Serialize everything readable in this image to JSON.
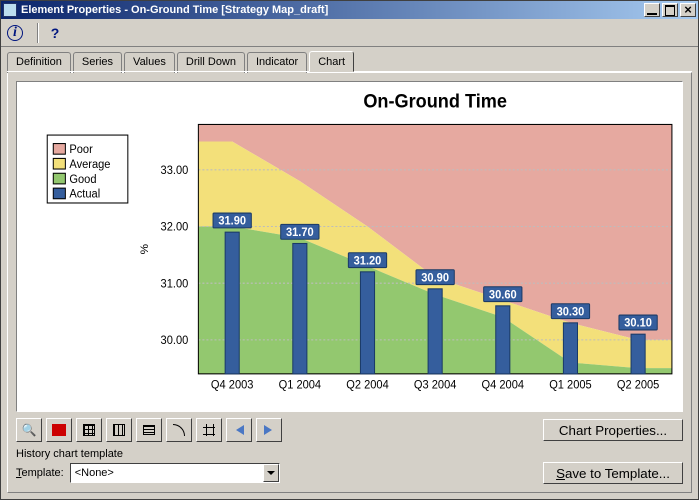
{
  "window": {
    "title": "Element Properties - On-Ground Time [Strategy Map_draft]"
  },
  "tabs": [
    {
      "label": "Definition"
    },
    {
      "label": "Series"
    },
    {
      "label": "Values"
    },
    {
      "label": "Drill Down"
    },
    {
      "label": "Indicator"
    },
    {
      "label": "Chart",
      "active": true
    }
  ],
  "buttons": {
    "chart_properties": "Chart Properties...",
    "save_to_template": "Save to Template..."
  },
  "template": {
    "group_label": "History chart template",
    "label": "Template:",
    "value": "<None>"
  },
  "legend": [
    "Poor",
    "Average",
    "Good",
    "Actual"
  ],
  "legend_colors": [
    "#e6a9a0",
    "#f3e07a",
    "#93c86f",
    "#355e9d"
  ],
  "chart_data": {
    "type": "bar",
    "title": "On-Ground Time",
    "ylabel": "%",
    "categories": [
      "Q4 2003",
      "Q1 2004",
      "Q2 2004",
      "Q3 2004",
      "Q4 2004",
      "Q1 2005",
      "Q2 2005"
    ],
    "series": [
      {
        "name": "Actual",
        "values": [
          31.9,
          31.7,
          31.2,
          30.9,
          30.6,
          30.3,
          30.1
        ],
        "type": "bar",
        "color": "#355e9d"
      }
    ],
    "bands": {
      "Poor_top": [
        33.8,
        33.8,
        33.8,
        33.8,
        33.8,
        33.8,
        33.8
      ],
      "Average_top": [
        33.5,
        32.8,
        32.0,
        31.1,
        30.7,
        30.3,
        30.0
      ],
      "Good_top": [
        32.0,
        31.8,
        31.3,
        30.8,
        30.4,
        29.6,
        29.5
      ],
      "Good_bottom": [
        29.4,
        29.4,
        29.4,
        29.4,
        29.4,
        29.4,
        29.4
      ]
    },
    "ylim": [
      29.4,
      33.8
    ],
    "yticks": [
      30.0,
      31.0,
      32.0,
      33.0
    ],
    "data_labels": [
      "31.90",
      "31.70",
      "31.20",
      "30.90",
      "30.60",
      "30.30",
      "30.10"
    ]
  }
}
